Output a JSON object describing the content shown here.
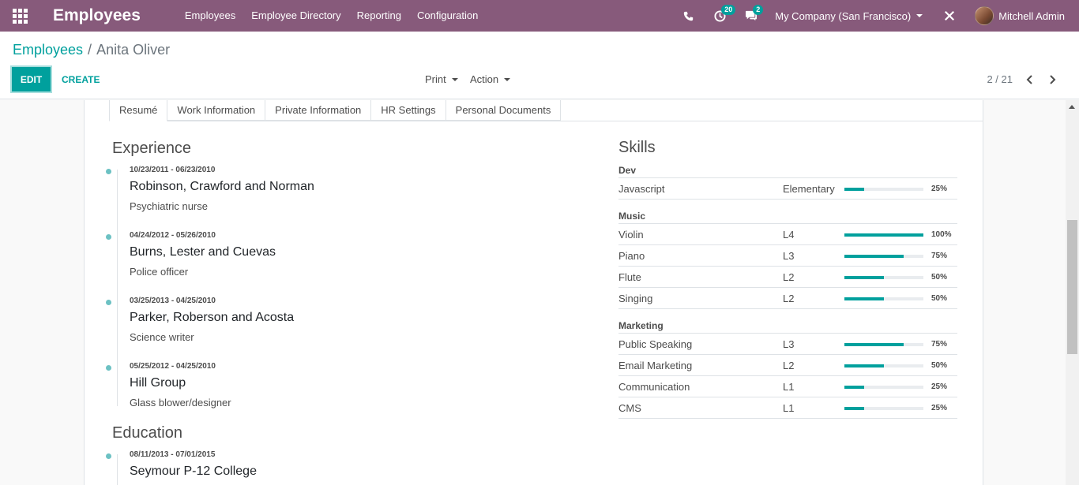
{
  "navbar": {
    "app_title": "Employees",
    "menu": [
      "Employees",
      "Employee Directory",
      "Reporting",
      "Configuration"
    ],
    "activity_count": "20",
    "messages_count": "2",
    "company": "My Company (San Francisco)",
    "user": "Mitchell Admin",
    "color": "#875a7b"
  },
  "breadcrumb": {
    "parent": "Employees",
    "separator": "/",
    "current": "Anita Oliver"
  },
  "toolbar": {
    "edit_label": "EDIT",
    "create_label": "CREATE",
    "print_label": "Print",
    "action_label": "Action",
    "pager": "2 / 21"
  },
  "tabs": [
    "Resumé",
    "Work Information",
    "Private Information",
    "HR Settings",
    "Personal Documents"
  ],
  "experience": {
    "title": "Experience",
    "entries": [
      {
        "date": "10/23/2011 - 06/23/2010",
        "name": "Robinson, Crawford and Norman",
        "desc": "Psychiatric nurse"
      },
      {
        "date": "04/24/2012 - 05/26/2010",
        "name": "Burns, Lester and Cuevas",
        "desc": "Police officer"
      },
      {
        "date": "03/25/2013 - 04/25/2010",
        "name": "Parker, Roberson and Acosta",
        "desc": "Science writer"
      },
      {
        "date": "05/25/2012 - 04/25/2010",
        "name": "Hill Group",
        "desc": "Glass blower/designer"
      }
    ]
  },
  "education": {
    "title": "Education",
    "entries": [
      {
        "date": "08/11/2013 - 07/01/2015",
        "name": "Seymour P-12 College"
      }
    ]
  },
  "skills": {
    "title": "Skills",
    "groups": [
      {
        "name": "Dev",
        "items": [
          {
            "name": "Javascript",
            "level": "Elementary",
            "pct": 25,
            "pct_label": "25%"
          }
        ]
      },
      {
        "name": "Music",
        "items": [
          {
            "name": "Violin",
            "level": "L4",
            "pct": 100,
            "pct_label": "100%"
          },
          {
            "name": "Piano",
            "level": "L3",
            "pct": 75,
            "pct_label": "75%"
          },
          {
            "name": "Flute",
            "level": "L2",
            "pct": 50,
            "pct_label": "50%"
          },
          {
            "name": "Singing",
            "level": "L2",
            "pct": 50,
            "pct_label": "50%"
          }
        ]
      },
      {
        "name": "Marketing",
        "items": [
          {
            "name": "Public Speaking",
            "level": "L3",
            "pct": 75,
            "pct_label": "75%"
          },
          {
            "name": "Email Marketing",
            "level": "L2",
            "pct": 50,
            "pct_label": "50%"
          },
          {
            "name": "Communication",
            "level": "L1",
            "pct": 25,
            "pct_label": "25%"
          },
          {
            "name": "CMS",
            "level": "L1",
            "pct": 25,
            "pct_label": "25%"
          }
        ]
      }
    ]
  },
  "colors": {
    "accent": "#00a09d",
    "primary": "#875a7b",
    "dot": "#6cc1c3"
  }
}
